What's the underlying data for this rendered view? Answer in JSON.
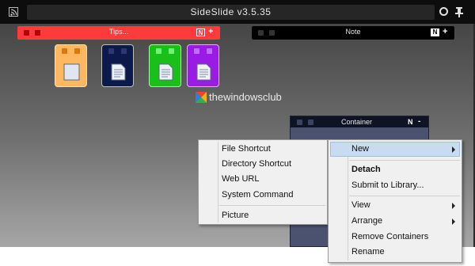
{
  "window": {
    "title": "SideSlide v3.5.35"
  },
  "bars": {
    "tips": {
      "label": "Tips...",
      "n_label": "N",
      "plus_label": "+"
    },
    "note": {
      "label": "Note",
      "n_label": "N",
      "plus_label": "+"
    }
  },
  "tiles": [
    {
      "name": "orange",
      "icon": "blank-document-icon"
    },
    {
      "name": "navy",
      "icon": "text-document-icon"
    },
    {
      "name": "green",
      "icon": "text-document-icon"
    },
    {
      "name": "purple",
      "icon": "text-document-icon"
    }
  ],
  "watermark": "thewindowsclub",
  "container": {
    "label": "Container",
    "n_label": "N",
    "minus_label": "-"
  },
  "submenu": {
    "items": [
      "File Shortcut",
      "Directory Shortcut",
      "Web URL",
      "System Command",
      "Picture"
    ]
  },
  "context_menu": {
    "new_label": "New",
    "detach_label": "Detach",
    "submit_label": "Submit to Library...",
    "view_label": "View",
    "arrange_label": "Arrange",
    "remove_label": "Remove Containers",
    "rename_label": "Rename"
  },
  "colors": {
    "tips_bar": "#ff3a3a",
    "orange_tile": "#ffb860",
    "navy_tile": "#0b1a4a",
    "green_tile": "#18c018",
    "purple_tile": "#9a1ae6",
    "menu_highlight": "#c9dcef"
  }
}
